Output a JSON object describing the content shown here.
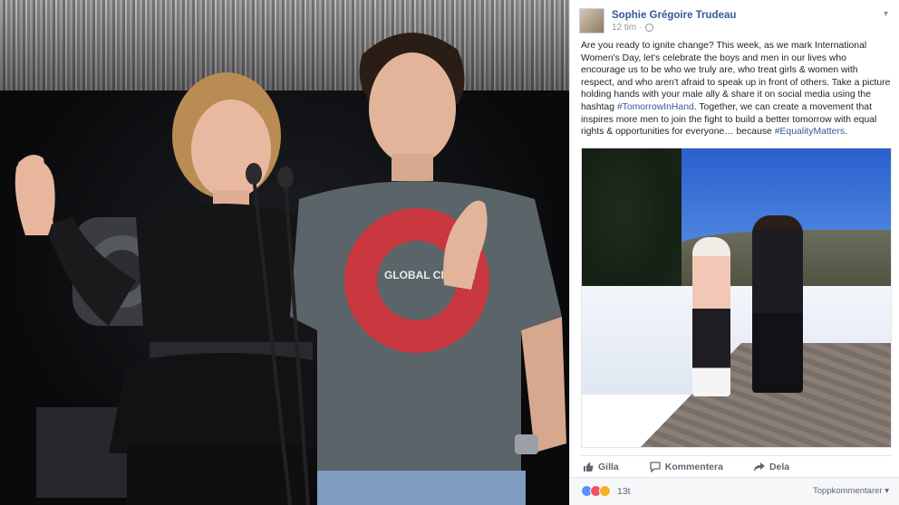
{
  "post": {
    "author": "Sophie Grégoire Trudeau",
    "time": "12 tim",
    "text_segments": [
      {
        "text": "Are you ready to ignite change? This week, as we mark International Women's Day, let's celebrate the boys and men in our lives who encourage us to be who we truly are, who treat girls & women with respect, and who aren't afraid to speak up in front of others. Take a picture holding hands with your male ally & share it on social media using the hashtag ",
        "type": "text"
      },
      {
        "text": "#TomorrowInHand",
        "type": "hashtag"
      },
      {
        "text": ". Together, we can create a movement that inspires more men to join the fight to build a better tomorrow with equal rights & opportunities for everyone… because ",
        "type": "text"
      },
      {
        "text": "#EqualityMatters",
        "type": "hashtag"
      },
      {
        "text": ".",
        "type": "text"
      }
    ]
  },
  "actions": {
    "like": "Gilla",
    "comment": "Kommentera",
    "share": "Dela"
  },
  "reactions": {
    "count": "13t",
    "sort_label": "Toppkommentarer ▾"
  },
  "stage_photo": {
    "shirt_text": "GLOBAL CITIZEN"
  },
  "icons": {
    "globe": "globe-icon",
    "chevron": "chevron-down-icon",
    "like": "thumbs-up-icon",
    "comment": "comment-icon",
    "share": "share-icon"
  },
  "colors": {
    "link": "#365899",
    "text": "#1d2129",
    "muted": "#90949c",
    "like_reaction": "#5890ff",
    "love_reaction": "#f25268",
    "haha_reaction": "#f7b125"
  }
}
